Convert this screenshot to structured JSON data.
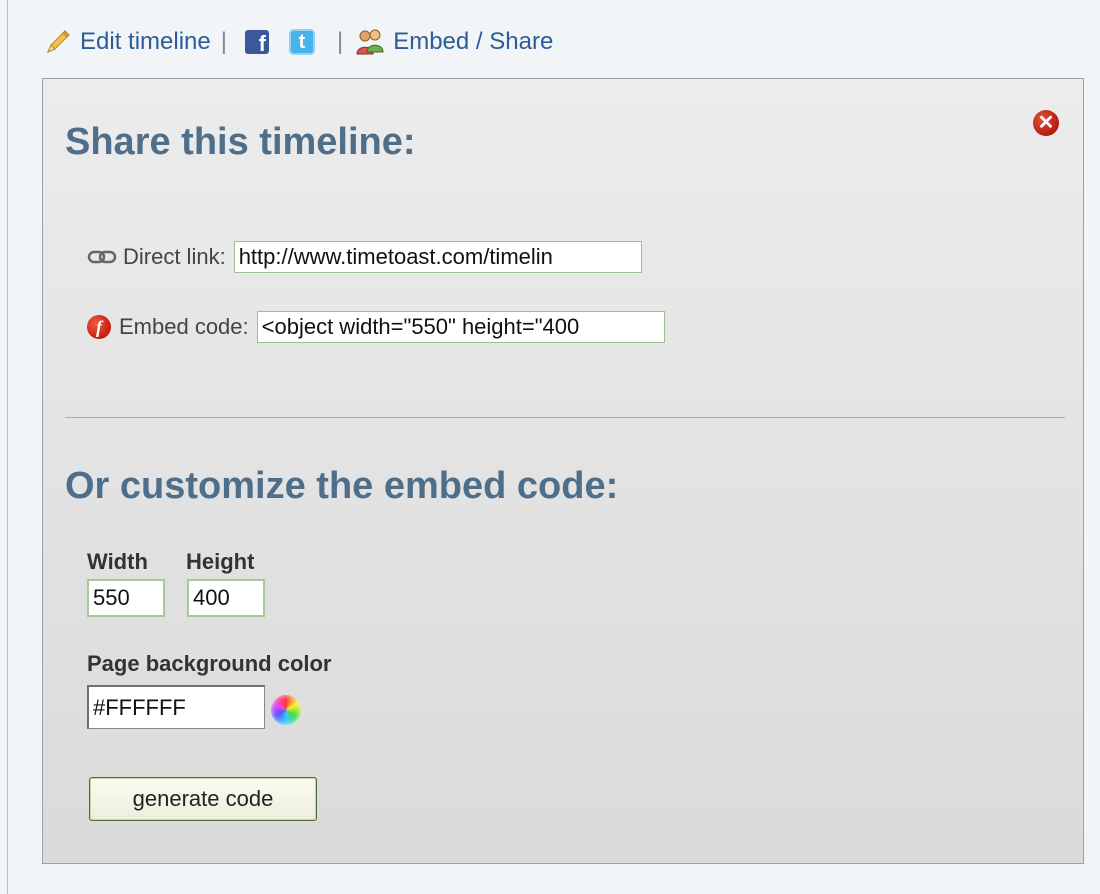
{
  "toolbar": {
    "edit_label": "Edit timeline",
    "separator": "|",
    "facebook_glyph": "f",
    "twitter_glyph": "t",
    "embed_label": "Embed / Share",
    "icons": [
      "pencil-icon",
      "facebook-icon",
      "twitter-icon",
      "people-icon"
    ]
  },
  "panel": {
    "close_glyph": "✕",
    "share_heading": "Share this timeline:",
    "direct_link": {
      "label": "Direct link:",
      "value": "http://www.timetoast.com/timelin"
    },
    "embed_code": {
      "label": "Embed code:",
      "value": "<object width=\"550\" height=\"400",
      "icon_glyph": "f"
    },
    "customize_heading": "Or customize the embed code:",
    "width": {
      "label": "Width",
      "value": "550"
    },
    "height": {
      "label": "Height",
      "value": "400"
    },
    "background": {
      "label": "Page background color",
      "value": "#FFFFFF"
    },
    "generate_label": "generate code"
  },
  "colors": {
    "link": "#2d5c97",
    "heading": "#4f6e8a",
    "close": "#b71c0c",
    "field_border": "#a9c99a"
  }
}
